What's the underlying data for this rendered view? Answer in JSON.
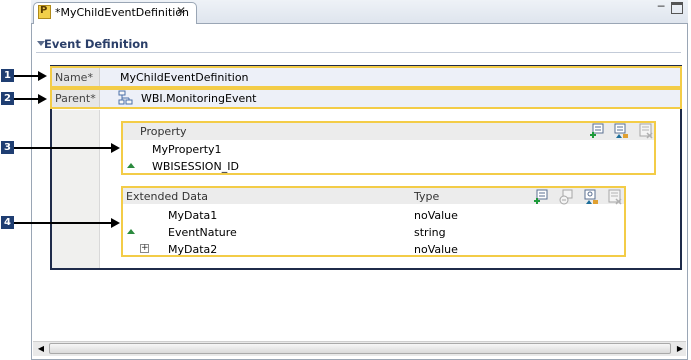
{
  "editor": {
    "tab_title": "*MyChildEventDefinition",
    "tab_close": "✕",
    "minimize_glyph": "─"
  },
  "section": {
    "title": "Event Definition"
  },
  "fields": {
    "name_label": "Name*",
    "name_value": "MyChildEventDefinition",
    "parent_label": "Parent*",
    "parent_value": "WBI.MonitoringEvent"
  },
  "property_group": {
    "header": "Property",
    "items": [
      "MyProperty1",
      "WBISESSION_ID"
    ]
  },
  "extended_data": {
    "columns": [
      "Extended Data",
      "Type"
    ],
    "rows": [
      {
        "name": "MyData1",
        "type": "noValue"
      },
      {
        "name": "EventNature",
        "type": "string"
      },
      {
        "name": "MyData2",
        "type": "noValue"
      }
    ]
  },
  "callouts": [
    "1",
    "2",
    "3",
    "4"
  ],
  "scrollbar": {
    "left_arrow": "◀",
    "right_arrow": "▶"
  },
  "colors": {
    "highlight_border": "#f3cc47",
    "container_border": "#1f2b4a",
    "callout_badge": "#1f3e72",
    "section_title": "#2b3f69",
    "inherited_marker": "#2b8a3e"
  },
  "icons": {
    "tab": "plan-file-icon",
    "parent": "event-hierarchy-icon",
    "property_tools": [
      "add-property-icon",
      "inherit-property-icon",
      "remove-property-icon"
    ],
    "extended_tools": [
      "add-extended-data-icon",
      "reference-extended-data-icon",
      "inherit-extended-data-icon",
      "remove-extended-data-icon"
    ]
  }
}
